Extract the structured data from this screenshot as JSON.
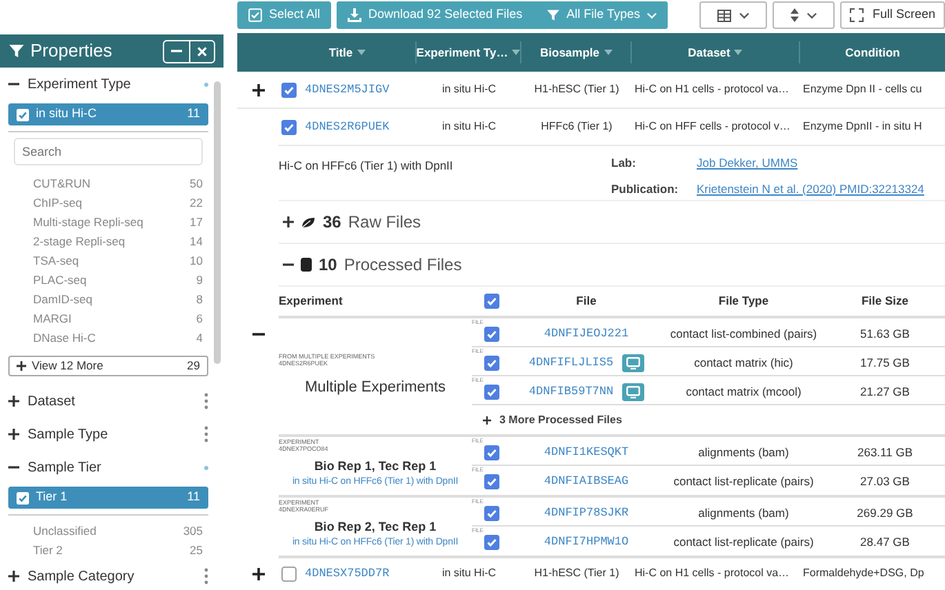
{
  "sidebar": {
    "title": "Properties",
    "facets": [
      {
        "title": "Experiment Type",
        "expanded": true,
        "selected_terms": [
          {
            "label": "in situ Hi-C",
            "count": "11"
          }
        ],
        "search": {
          "placeholder": "Search"
        },
        "terms": [
          {
            "label": "CUT&RUN",
            "count": "50"
          },
          {
            "label": "ChIP-seq",
            "count": "22"
          },
          {
            "label": "Multi-stage Repli-seq",
            "count": "17"
          },
          {
            "label": "2-stage Repli-seq",
            "count": "14"
          },
          {
            "label": "TSA-seq",
            "count": "10"
          },
          {
            "label": "PLAC-seq",
            "count": "9"
          },
          {
            "label": "DamID-seq",
            "count": "8"
          },
          {
            "label": "MARGI",
            "count": "6"
          },
          {
            "label": "DNase Hi-C",
            "count": "4"
          }
        ],
        "more": {
          "label": "View 12 More",
          "count": "29"
        }
      },
      {
        "title": "Dataset",
        "expanded": false
      },
      {
        "title": "Sample Type",
        "expanded": false
      },
      {
        "title": "Sample Tier",
        "expanded": true,
        "selected_terms": [
          {
            "label": "Tier 1",
            "count": "11"
          }
        ],
        "terms": [
          {
            "label": "Unclassified",
            "count": "305"
          },
          {
            "label": "Tier 2",
            "count": "25"
          }
        ]
      },
      {
        "title": "Sample Category",
        "expanded": false
      }
    ]
  },
  "toolbar": {
    "buttons": [
      {
        "kind": "select",
        "label": "Select All"
      },
      {
        "kind": "download",
        "label": "Download 92 Selected Files"
      },
      {
        "kind": "filter",
        "label": "All File Types"
      }
    ],
    "right_buttons": [
      {
        "kind": "columns"
      },
      {
        "kind": "sort"
      },
      {
        "kind": "fullscreen",
        "label": "Full Screen"
      }
    ]
  },
  "table": {
    "columns": [
      {
        "label": "Title",
        "menu": true
      },
      {
        "label": "Experiment Ty…",
        "menu": true
      },
      {
        "label": "Biosample",
        "menu": true
      },
      {
        "label": "Dataset",
        "menu": true
      },
      {
        "label": "Condition",
        "menu": false
      }
    ],
    "rows": [
      {
        "expanded": false,
        "checked": true,
        "cells": [
          "4DNES2M5JIGV",
          "in situ Hi-C",
          "H1-hESC (Tier 1)",
          "Hi-C on H1 cells - protocol va…",
          "Enzyme Dpn II - cells cu"
        ]
      },
      {
        "expanded": true,
        "checked": true,
        "cells": [
          "4DNES2R6PUEK",
          "in situ Hi-C",
          "HFFc6 (Tier 1)",
          "Hi-C on HFF cells - protocol v…",
          "Enzyme DpnII - in situ H"
        ],
        "detail": {
          "description": "Hi-C on HFFc6 (Tier 1) with DpnII",
          "fields": [
            {
              "label": "Lab:",
              "value": "Job Dekker, UMMS"
            },
            {
              "label": "Publication:",
              "value": "Krietenstein N et al. (2020) PMID:32213324"
            }
          ],
          "sections": [
            {
              "kind": "raw",
              "expanded": false,
              "count": "36",
              "label": "Raw Files"
            },
            {
              "kind": "processed",
              "expanded": true,
              "count": "10",
              "label": "Processed Files"
            }
          ],
          "processed_table": {
            "columns": [
              "Experiment",
              "File",
              "File Type",
              "File Size"
            ],
            "header_checked": true,
            "groups": [
              {
                "kind": "multiple",
                "caption": "FROM MULTIPLE EXPERIMENTS",
                "id": "4DNES2R6PUEK",
                "title": "Multiple Experiments",
                "more": "3 More Processed Files",
                "files": [
                  {
                    "tag": "FILE",
                    "accession": "4DNFIJEOJ221",
                    "checked": true,
                    "visualize": false,
                    "file_type": "contact list-combined (pairs)",
                    "size": "51.63 GB"
                  },
                  {
                    "tag": "FILE",
                    "accession": "4DNFIFLJLIS5",
                    "checked": true,
                    "visualize": true,
                    "file_type": "contact matrix (hic)",
                    "size": "17.75 GB"
                  },
                  {
                    "tag": "FILE",
                    "accession": "4DNFIB59T7NN",
                    "checked": true,
                    "visualize": true,
                    "file_type": "contact matrix (mcool)",
                    "size": "21.27 GB"
                  }
                ]
              },
              {
                "kind": "experiment",
                "caption": "EXPERIMENT",
                "id": "4DNEX7POCO84",
                "title": "Bio Rep 1, Tec Rep 1",
                "link": "in situ Hi-C on HFFc6 (Tier 1) with DpnII",
                "files": [
                  {
                    "tag": "FILE",
                    "accession": "4DNFI1KESQKT",
                    "checked": true,
                    "visualize": false,
                    "file_type": "alignments (bam)",
                    "size": "263.11 GB"
                  },
                  {
                    "tag": "FILE",
                    "accession": "4DNFIAIBSEAG",
                    "checked": true,
                    "visualize": false,
                    "file_type": "contact list-replicate (pairs)",
                    "size": "27.03 GB"
                  }
                ]
              },
              {
                "kind": "experiment",
                "caption": "EXPERIMENT",
                "id": "4DNEXRA0ERUF",
                "title": "Bio Rep 2, Tec Rep 1",
                "link": "in situ Hi-C on HFFc6 (Tier 1) with DpnII",
                "files": [
                  {
                    "tag": "FILE",
                    "accession": "4DNFIP78SJKR",
                    "checked": true,
                    "visualize": false,
                    "file_type": "alignments (bam)",
                    "size": "269.29 GB"
                  },
                  {
                    "tag": "FILE",
                    "accession": "4DNFI7HPMW1O",
                    "checked": true,
                    "visualize": false,
                    "file_type": "contact list-replicate (pairs)",
                    "size": "28.47 GB"
                  }
                ]
              }
            ]
          }
        }
      },
      {
        "expanded": false,
        "checked": false,
        "cells": [
          "4DNESX75DD7R",
          "in situ Hi-C",
          "H1-hESC (Tier 1)",
          "Hi-C on H1 cells - protocol va…",
          "Formaldehyde+DSG, Dp"
        ]
      }
    ]
  }
}
